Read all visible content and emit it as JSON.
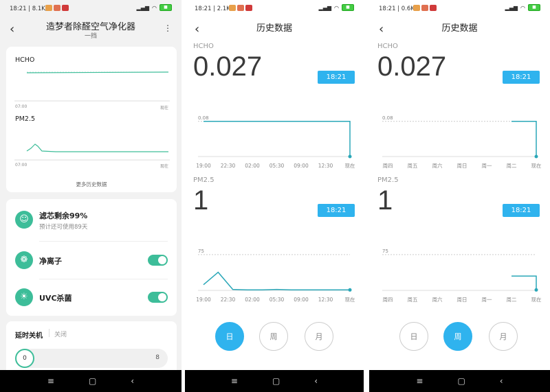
{
  "colors": {
    "teal": "#3dbd99",
    "blue": "#2fb3ee",
    "line": "#2aa7b8"
  },
  "panel1": {
    "status": {
      "time": "18:21 | 8.1K/s"
    },
    "title": "造梦者除醛空气净化器",
    "subtitle": "一挡",
    "card": {
      "hcho_label": "HCHO",
      "hcho_x_start": "07:00",
      "hcho_x_end": "现在",
      "pm_label": "PM2.5",
      "pm_x_start": "07:00",
      "pm_x_end": "现在",
      "more_link": "更多历史数据"
    },
    "filter": {
      "title": "滤芯剩余99%",
      "subtitle": "预计还可使用89天",
      "icon": "filter-icon"
    },
    "ion": {
      "title": "净离子",
      "icon": "ion-icon",
      "on": true
    },
    "uvc": {
      "title": "UVC杀菌",
      "icon": "sun-icon",
      "on": true
    },
    "timer": {
      "label": "延时关机",
      "state": "关闭",
      "value_start": "0",
      "value_end": "8"
    }
  },
  "panel2": {
    "status": {
      "time": "18:21 | 2.1K/s"
    },
    "title": "历史数据",
    "hcho_label": "HCHO",
    "hcho_value": "0.027",
    "hcho_badge": "18:21",
    "pm_label": "PM2.5",
    "pm_value": "1",
    "pm_badge": "18:21",
    "range": {
      "day": "日",
      "week": "周",
      "month": "月",
      "selected": "day"
    }
  },
  "panel3": {
    "status": {
      "time": "18:21 | 0.6K/s"
    },
    "title": "历史数据",
    "hcho_label": "HCHO",
    "hcho_value": "0.027",
    "hcho_badge": "18:21",
    "pm_label": "PM2.5",
    "pm_value": "1",
    "pm_badge": "18:21",
    "range": {
      "day": "日",
      "week": "周",
      "month": "月",
      "selected": "week"
    }
  },
  "chart_data": [
    {
      "type": "line",
      "name": "日-HCHO",
      "x": [
        "19:00",
        "22:30",
        "02:00",
        "05:30",
        "09:00",
        "12:30",
        "现在"
      ],
      "gridline_label": "0.08",
      "series": [
        {
          "values": [
            0.08,
            0.08,
            0.08,
            0.08,
            0.08,
            0.08,
            0
          ]
        }
      ]
    },
    {
      "type": "line",
      "name": "日-PM2.5",
      "x": [
        "19:00",
        "22:30",
        "02:00",
        "05:30",
        "09:00",
        "12:30",
        "现在"
      ],
      "gridline_label": "75",
      "series": [
        {
          "values": [
            12,
            38,
            2,
            1,
            1,
            2,
            1,
            1,
            1,
            1,
            1
          ]
        }
      ]
    },
    {
      "type": "line",
      "name": "周-HCHO",
      "x": [
        "周四",
        "周五",
        "周六",
        "周日",
        "周一",
        "周二",
        "现在"
      ],
      "gridline_label": "0.08",
      "series": [
        {
          "values": [
            null,
            null,
            null,
            null,
            null,
            0.08,
            0
          ]
        }
      ]
    },
    {
      "type": "line",
      "name": "周-PM2.5",
      "x": [
        "周四",
        "周五",
        "周六",
        "周日",
        "周一",
        "周二",
        "现在"
      ],
      "gridline_label": "75",
      "series": [
        {
          "values": [
            null,
            null,
            null,
            null,
            null,
            30,
            1
          ]
        }
      ]
    }
  ]
}
